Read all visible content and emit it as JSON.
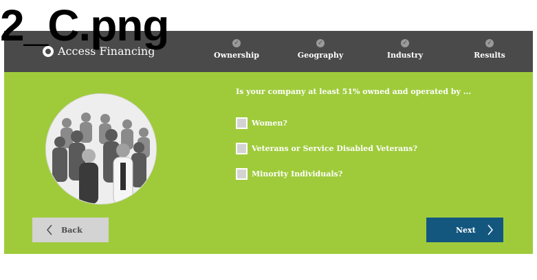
{
  "overlay": {
    "title": "2_C.png"
  },
  "header": {
    "brand": "Access Financing",
    "steps": [
      {
        "label": "Ownership"
      },
      {
        "label": "Geography"
      },
      {
        "label": "Industry"
      },
      {
        "label": "Results"
      }
    ]
  },
  "main": {
    "question": "Is your company at least 51% owned and operated by ...",
    "options": [
      {
        "label": "Women?",
        "checked": false
      },
      {
        "label": "Veterans or Service Disabled Veterans?",
        "checked": false
      },
      {
        "label": "Minority Individuals?",
        "checked": false
      }
    ]
  },
  "nav": {
    "back_label": "Back",
    "next_label": "Next"
  },
  "colors": {
    "header_bg": "#4a4a4a",
    "panel_bg": "#9fcb3b",
    "next_bg": "#13577f",
    "back_bg": "#d3d3d3",
    "checkbox_bg": "#d3d3d3"
  },
  "icons": {
    "step_status": "check-circle-icon",
    "brand": "logo-icon",
    "back": "chevron-left-icon",
    "next": "chevron-right-icon"
  }
}
